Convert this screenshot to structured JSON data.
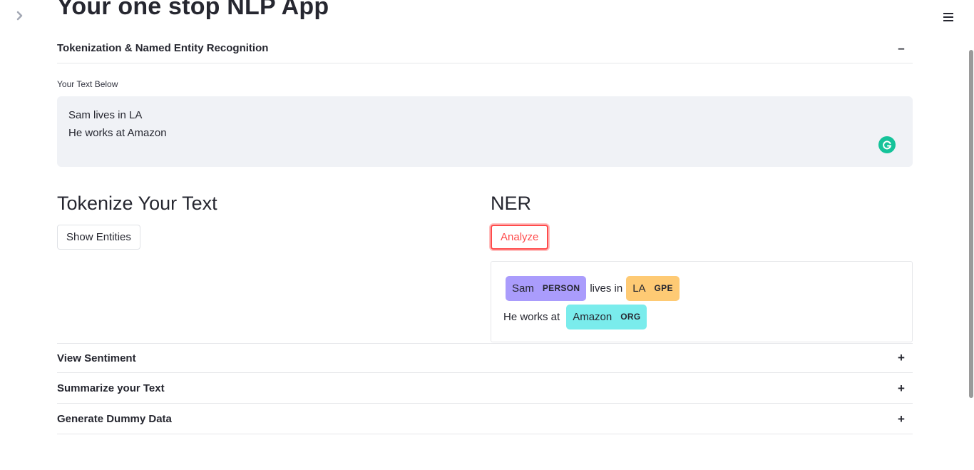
{
  "page": {
    "title": "Your one stop NLP App"
  },
  "expanders": [
    {
      "label": "Tokenization & Named Entity Recognition",
      "toggle": "–",
      "expanded": true
    },
    {
      "label": "View Sentiment",
      "toggle": "+",
      "expanded": false
    },
    {
      "label": "Summarize your Text",
      "toggle": "+",
      "expanded": false
    },
    {
      "label": "Generate Dummy Data",
      "toggle": "+",
      "expanded": false
    }
  ],
  "text_input": {
    "label": "Your Text Below",
    "lines": [
      "Sam lives in LA",
      "He works at Amazon"
    ]
  },
  "tokenize": {
    "heading": "Tokenize Your Text",
    "button_label": "Show Entities"
  },
  "ner": {
    "heading": "NER",
    "button_label": "Analyze",
    "line1": {
      "ent1": {
        "text": "Sam",
        "label": "PERSON",
        "color": "#aa9cfc"
      },
      "plain1": "lives in",
      "ent2": {
        "text": "LA",
        "label": "GPE",
        "color": "#feca74"
      }
    },
    "line2": {
      "plain1": "He works at",
      "ent1": {
        "text": "Amazon",
        "label": "ORG",
        "color": "#7aecec"
      }
    }
  },
  "icons": {
    "sidebar_toggle": "chevron-right-icon",
    "menu": "hamburger-menu-icon",
    "grammarly": "grammarly-icon"
  },
  "colors": {
    "primary": "#ff4b4b",
    "text_area_bg": "#f0f2f6",
    "grammarly": "#15c39a"
  }
}
